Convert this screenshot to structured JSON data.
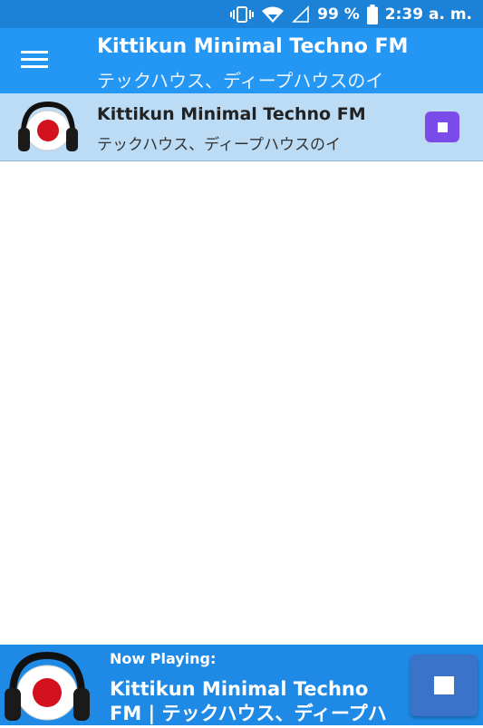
{
  "status_bar": {
    "icons": [
      "vibrate-icon",
      "wifi-icon",
      "signal-icon",
      "battery-icon"
    ],
    "battery": "99 %",
    "time": "2:39 a. m."
  },
  "app_bar": {
    "menu_icon": "hamburger-menu-icon",
    "title": "Kittikun Minimal Techno FM",
    "subtitle": "テックハウス、ディープハウスのイ"
  },
  "station_list": [
    {
      "name": "Kittikun Minimal Techno FM",
      "subtitle": "テックハウス、ディープハウスのイ",
      "logo_icon": "japan-flag-headphones-icon",
      "action_icon": "stop-icon"
    }
  ],
  "now_playing": {
    "label": "Now Playing:",
    "title_line1": "Kittikun Minimal Techno",
    "title_line2": "FM | テックハウス、ディープハ",
    "logo_icon": "japan-flag-headphones-icon",
    "action_icon": "stop-icon"
  },
  "colors": {
    "status_bar": "#1b82d8",
    "app_bar": "#2496f3",
    "selected_row": "#bcdcf6",
    "row_stop": "#7a4be8",
    "now_bar": "#1f8ae6",
    "big_stop": "#3a73c8",
    "flag_red": "#d3121f"
  }
}
